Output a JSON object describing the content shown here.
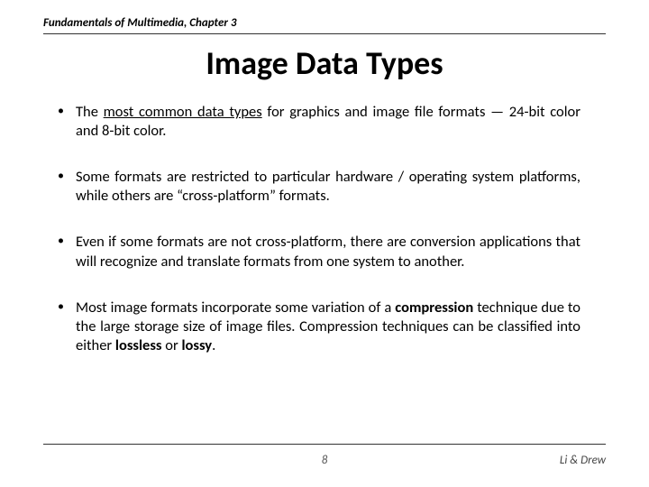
{
  "header": {
    "chapter": "Fundamentals of Multimedia, Chapter 3"
  },
  "title": "Image Data Types",
  "bullets": {
    "b1": {
      "before": "The ",
      "underlined": "most common data types",
      "after": " for graphics and image file formats — 24-bit color and 8-bit color."
    },
    "b2": "Some formats are restricted to particular hardware / operating system platforms, while others are “cross-platform” formats.",
    "b3": "Even if some formats are not cross-platform, there are conversion applications that will recognize and translate formats from one system to another.",
    "b4": {
      "p1": "Most image formats incorporate some variation of a ",
      "bold1": "compression",
      "p2": " technique due to the large storage size of image files. Compression techniques can be classified into either ",
      "bold2": "lossless",
      "p3": " or ",
      "bold3": "lossy",
      "p4": "."
    }
  },
  "footer": {
    "page": "8",
    "authors": "Li & Drew"
  }
}
